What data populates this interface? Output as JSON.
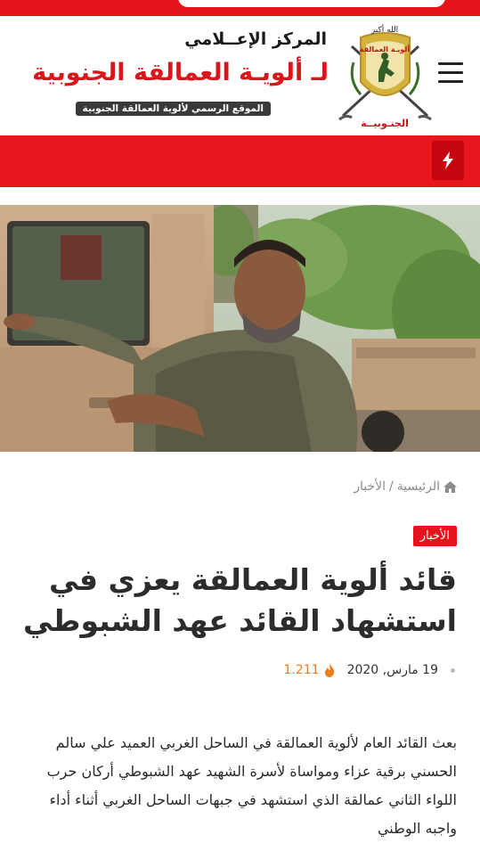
{
  "header": {
    "brand_line1": "المركز الإعــلامي",
    "brand_line2": "لـ ألويـة العمالقة الجنوبية",
    "tagline": "الموقع الرسمي لألوية العمالقة الجنوبية",
    "logo_text_top": "الله أكبر",
    "logo_text_mid": "ألويـة العمالقة",
    "logo_text_bottom": "الجنـوبيــة"
  },
  "breadcrumb": {
    "home": "الرئيسية",
    "separator": "/",
    "current": "الأخبار"
  },
  "article": {
    "category": "الأخبار",
    "title": "قائد ألوية العمالقة يعزي في استشهاد القائد عهد الشبوطي",
    "date": "19 مارس, 2020",
    "views": "1.211",
    "body": "بعث القائد العام لألوية العمالقة في الساحل الغربي العميد علي سالم الحسني برقية عزاء ومواساة لأسرة الشهيد عهد الشبوطي أركان حرب اللواء الثاني عمالقة الذي استشهد في جبهات الساحل الغربي أثناء أداء واجبه الوطني"
  },
  "colors": {
    "accent": "#e5151b",
    "accent_dark": "#c4070e",
    "views": "#f07c1a"
  },
  "icons": {
    "menu": "hamburger-menu-icon",
    "breaking": "lightning-bolt-icon",
    "home": "home-icon",
    "views": "fire-icon"
  }
}
